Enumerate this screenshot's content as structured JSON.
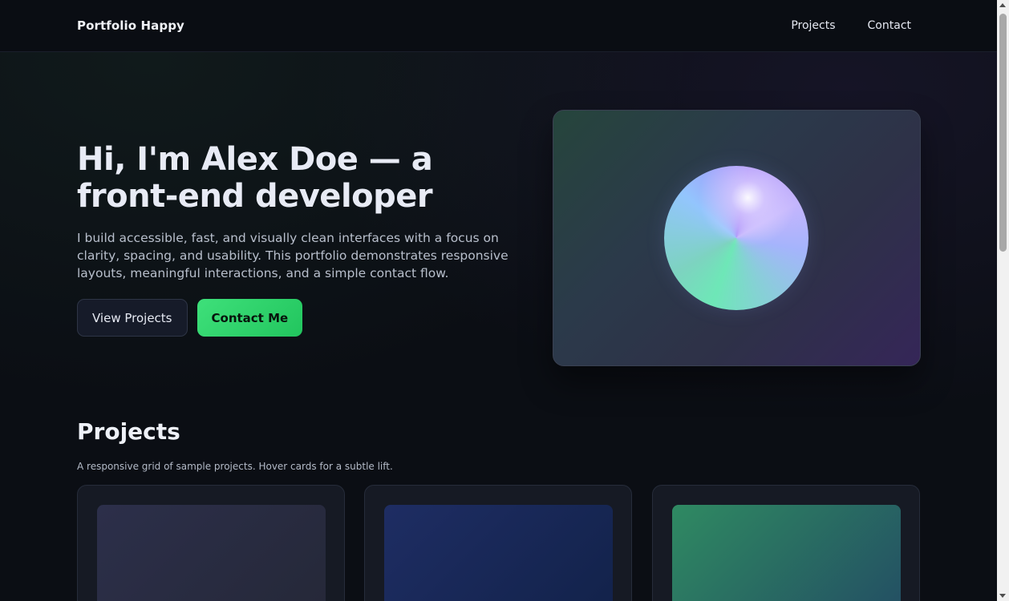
{
  "nav": {
    "brand": "Portfolio Happy",
    "links": [
      "Projects",
      "Contact"
    ]
  },
  "hero": {
    "title": "Hi, I'm Alex Doe — a front-end developer",
    "description": "I build accessible, fast, and visually clean interfaces with a focus on clarity, spacing, and usability. This portfolio demonstrates responsive layouts, meaningful interactions, and a simple contact flow.",
    "buttons": {
      "secondary": "View Projects",
      "primary": "Contact Me"
    }
  },
  "projects": {
    "title": "Projects",
    "subtitle": "A responsive grid of sample projects. Hover cards for a subtle lift.",
    "cards": [
      {
        "thumb_colors": [
          "#2c2f4a",
          "#252838"
        ]
      },
      {
        "thumb_colors": [
          "#1e2d63",
          "#12224a"
        ]
      },
      {
        "thumb_colors": [
          "#2f8a62",
          "#234e63"
        ]
      }
    ]
  },
  "colors": {
    "accent": "#22c55e",
    "background": "#0b0e14"
  }
}
